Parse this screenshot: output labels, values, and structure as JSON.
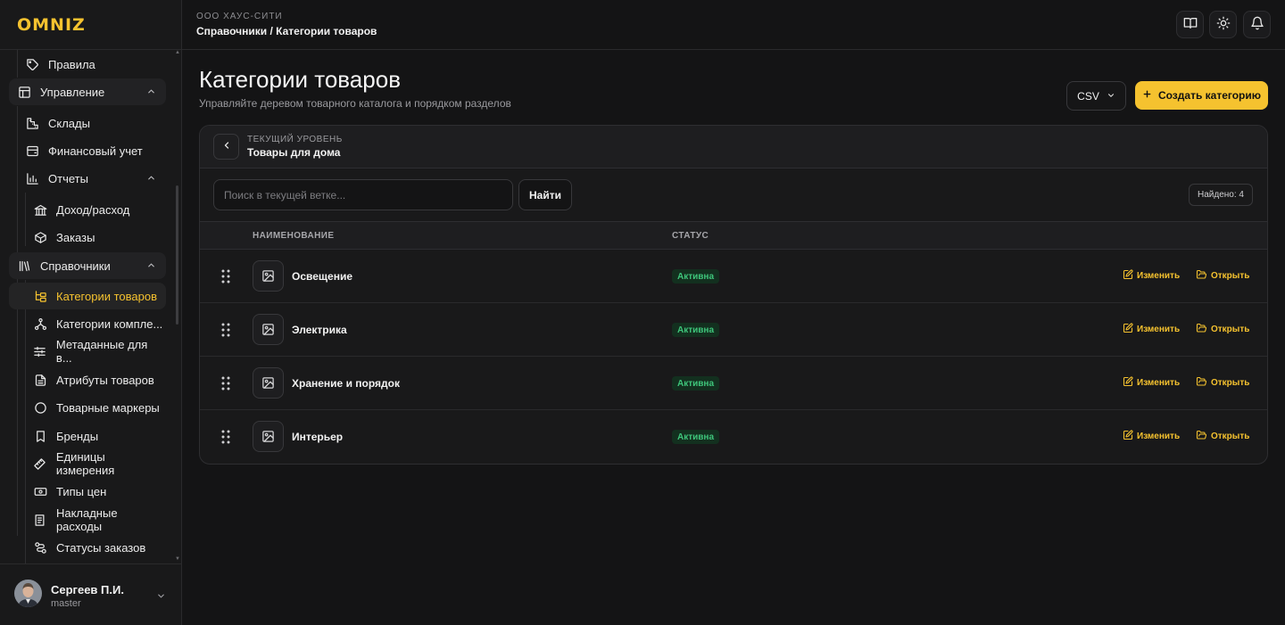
{
  "app": {
    "logo": "OMNIZ"
  },
  "topbar": {
    "org": "ООО ХАУС-СИТИ",
    "breadcrumb": "Справочники / Категории товаров"
  },
  "header": {
    "title": "Категории товаров",
    "subtitle": "Управляйте деревом товарного каталога и порядком разделов",
    "csv_label": "CSV",
    "create_label": "Создать категорию"
  },
  "sidebar": {
    "items": [
      {
        "label": "Правила",
        "icon": "tag-icon"
      },
      {
        "label": "Управление",
        "icon": "layout-icon"
      },
      {
        "label": "Склады",
        "icon": "warehouse-icon"
      },
      {
        "label": "Финансовый учет",
        "icon": "wallet-icon"
      },
      {
        "label": "Отчеты",
        "icon": "bar-chart-icon"
      },
      {
        "label": "Доход/расход",
        "icon": "bank-icon"
      },
      {
        "label": "Заказы",
        "icon": "box-icon"
      },
      {
        "label": "Справочники",
        "icon": "library-icon"
      },
      {
        "label": "Категории товаров",
        "icon": "folder-tree-icon"
      },
      {
        "label": "Категории компле...",
        "icon": "network-icon"
      },
      {
        "label": "Метаданные для в...",
        "icon": "sliders-icon"
      },
      {
        "label": "Атрибуты товаров",
        "icon": "file-text-icon"
      },
      {
        "label": "Товарные маркеры",
        "icon": "circle-icon"
      },
      {
        "label": "Бренды",
        "icon": "bookmark-icon"
      },
      {
        "label": "Единицы измерения",
        "icon": "ruler-icon"
      },
      {
        "label": "Типы цен",
        "icon": "banknote-icon"
      },
      {
        "label": "Накладные расходы",
        "icon": "receipt-icon"
      },
      {
        "label": "Статусы заказов",
        "icon": "route-icon"
      }
    ]
  },
  "user": {
    "name": "Сергеев П.И.",
    "role": "master"
  },
  "level": {
    "label": "ТЕКУЩИЙ УРОВЕНЬ",
    "name": "Товары для дома"
  },
  "search": {
    "placeholder": "Поиск в текущей ветке...",
    "button": "Найти",
    "found": "Найдено: 4"
  },
  "table": {
    "columns": [
      "НАИМЕНОВАНИЕ",
      "СТАТУС"
    ],
    "edit_label": "Изменить",
    "open_label": "Открыть",
    "rows": [
      {
        "name": "Освещение",
        "status": "Активна"
      },
      {
        "name": "Электрика",
        "status": "Активна"
      },
      {
        "name": "Хранение и порядок",
        "status": "Активна"
      },
      {
        "name": "Интерьер",
        "status": "Активна"
      }
    ]
  },
  "colors": {
    "accent": "#f5c22f",
    "background": "#141415",
    "status_active": "#3ec47a"
  }
}
